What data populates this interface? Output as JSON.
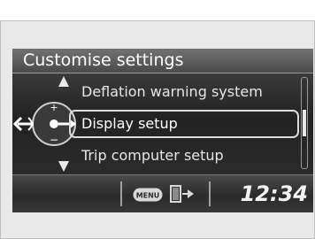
{
  "screen": {
    "title": "Customise settings",
    "items": [
      {
        "label": "Deflation warning system",
        "selected": false
      },
      {
        "label": "Display setup",
        "selected": true
      },
      {
        "label": "Trip computer setup",
        "selected": false
      }
    ]
  },
  "status_bar": {
    "menu_icon_label": "MENU",
    "time": "12:34"
  },
  "icons": {
    "dial": "interface-dial-icon",
    "menu": "menu-button-icon",
    "exit": "exit-door-icon"
  },
  "colors": {
    "screen_bg": "#1c1c1c",
    "text": "#ffffff",
    "highlight": "#dcdcdc"
  }
}
